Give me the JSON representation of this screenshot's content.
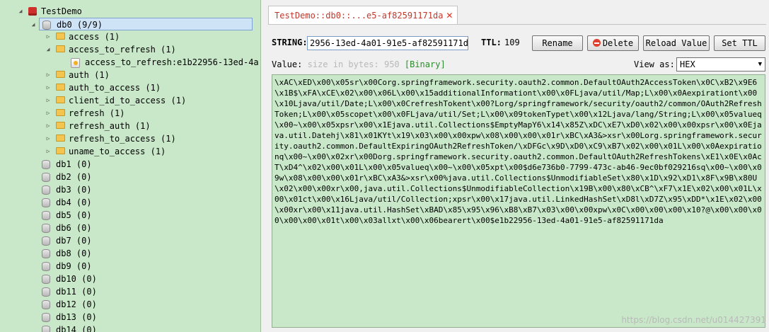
{
  "tree": {
    "root": {
      "label": "TestDemo",
      "icon": "redis-server-icon"
    },
    "db0": {
      "label": "db0  (9/9)"
    },
    "db0_children": [
      {
        "label": "access (1)",
        "expanded": false
      },
      {
        "label": "access_to_refresh (1)",
        "expanded": true,
        "children": [
          {
            "label": "access_to_refresh:e1b22956-13ed-4a"
          }
        ]
      },
      {
        "label": "auth (1)",
        "expanded": false
      },
      {
        "label": "auth_to_access (1)",
        "expanded": false
      },
      {
        "label": "client_id_to_access (1)",
        "expanded": false
      },
      {
        "label": "refresh (1)",
        "expanded": false
      },
      {
        "label": "refresh_auth (1)",
        "expanded": false
      },
      {
        "label": "refresh_to_access (1)",
        "expanded": false
      },
      {
        "label": "uname_to_access (1)",
        "expanded": false
      }
    ],
    "dbs": [
      "db1  (0)",
      "db2  (0)",
      "db3  (0)",
      "db4  (0)",
      "db5  (0)",
      "db6  (0)",
      "db7  (0)",
      "db8  (0)",
      "db9  (0)",
      "db10  (0)",
      "db11  (0)",
      "db12  (0)",
      "db13  (0)",
      "db14  (0)"
    ]
  },
  "tab": {
    "title": "TestDemo::db0::...e5-af82591171da",
    "close": "✕"
  },
  "key": {
    "type_label": "STRING:",
    "name": "2956-13ed-4a01-91e5-af82591171da",
    "ttl_label": "TTL:",
    "ttl_value": "109"
  },
  "buttons": {
    "rename": "Rename",
    "delete": "Delete",
    "reload": "Reload Value",
    "set_ttl": "Set TTL"
  },
  "value": {
    "label": "Value:",
    "size_placeholder": "size in bytes: 950",
    "binary_tag": "[Binary]",
    "view_as_label": "View as:",
    "view_as_selected": "HEX",
    "text": "\\xAC\\xED\\x00\\x05sr\\x00Corg.springframework.security.oauth2.common.DefaultOAuth2AccessToken\\x0C\\xB2\\x9E6\\x1B$\\xFA\\xCE\\x02\\x00\\x06L\\x00\\x15additionalInformationt\\x00\\x0FLjava/util/Map;L\\x00\\x0Aexpirationt\\x00\\x10Ljava/util/Date;L\\x00\\x0CrefreshTokent\\x00?Lorg/springframework/security/oauth2/common/OAuth2RefreshToken;L\\x00\\x05scopet\\x00\\x0FLjava/util/Set;L\\x00\\x09tokenTypet\\x00\\x12Ljava/lang/String;L\\x00\\x05valueq\\x00~\\x00\\x05xpsr\\x00\\x1Ejava.util.Collections$EmptyMapY6\\x14\\x85Z\\xDC\\xE7\\xD0\\x02\\x00\\x00xpsr\\x00\\x0Ejava.util.Datehj\\x81\\x01KYt\\x19\\x03\\x00\\x00xpw\\x08\\x00\\x00\\x01r\\xBC\\xA3&>xsr\\x00Lorg.springframework.security.oauth2.common.DefaultExpiringOAuth2RefreshToken/\\xDFGc\\x9D\\xD0\\xC9\\xB7\\x02\\x00\\x01L\\x00\\x0Aexpirationq\\x00~\\x00\\x02xr\\x00Dorg.springframework.security.oauth2.common.DefaultOAuth2RefreshTokens\\xE1\\x0E\\x0AcT\\xD4^\\x02\\x00\\x01L\\x00\\x05valueq\\x00~\\x00\\x05xpt\\x00$d6e736b0-7799-473c-ab46-9ec0bf029216sq\\x00~\\x00\\x09w\\x08\\x00\\x00\\x01r\\xBC\\xA3&>xsr\\x00%java.util.Collections$UnmodifiableSet\\x80\\x1D\\x92\\xD1\\x8F\\x9B\\x80U\\x02\\x00\\x00xr\\x00,java.util.Collections$UnmodifiableCollection\\x19B\\x00\\x80\\xCB^\\xF7\\x1E\\x02\\x00\\x01L\\x00\\x01ct\\x00\\x16Ljava/util/Collection;xpsr\\x00\\x17java.util.LinkedHashSet\\xD8l\\xD7Z\\x95\\xDD*\\x1E\\x02\\x00\\x00xr\\x00\\x11java.util.HashSet\\xBAD\\x85\\x95\\x96\\xB8\\xB7\\x03\\x00\\x00xpw\\x0C\\x00\\x00\\x00\\x10?@\\x00\\x00\\x00\\x00\\x00\\x01t\\x00\\x03allxt\\x00\\x06bearert\\x00$e1b22956-13ed-4a01-91e5-af82591171da"
  },
  "watermark": "https://blog.csdn.net/u014427391"
}
